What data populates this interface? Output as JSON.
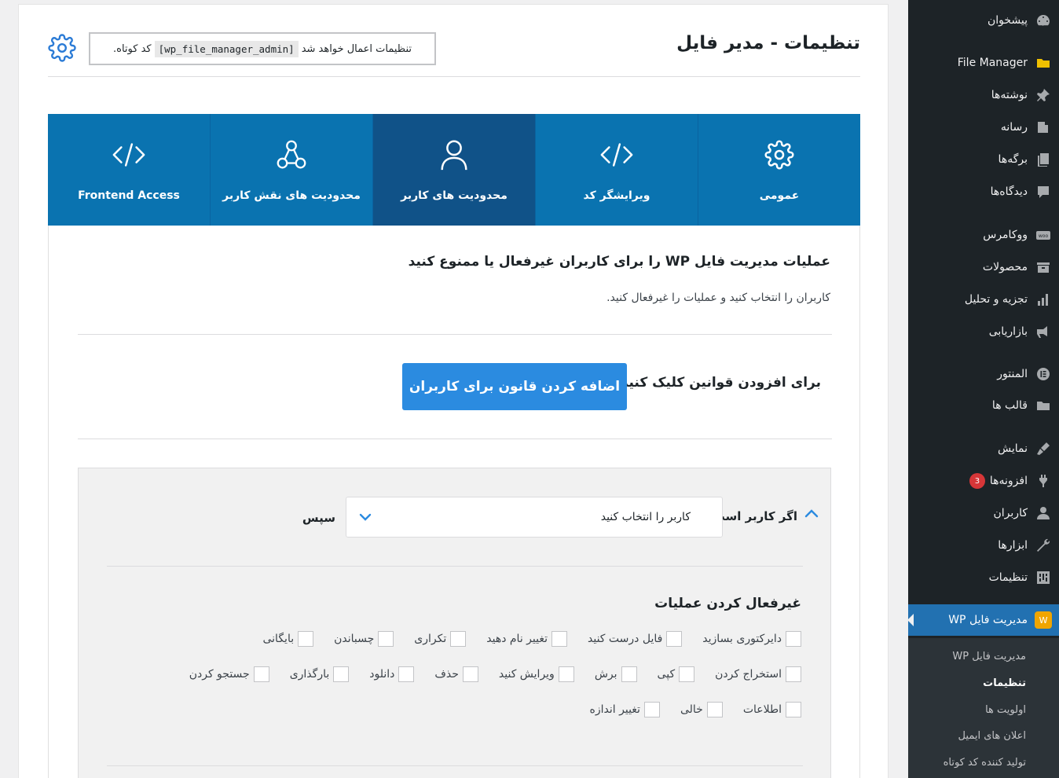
{
  "header": {
    "title": "تنظیمات - مدیر فایل",
    "shortcode_text_before": "تنظیمات اعمال خواهد شد",
    "shortcode_code": "[wp_file_manager_admin]",
    "shortcode_text_after": "کد کوتاه."
  },
  "tabs": [
    {
      "label": "Frontend Access",
      "icon": "code-icon"
    },
    {
      "label": "محدودیت های نقش کاربر",
      "icon": "user-roles-icon"
    },
    {
      "label": "محدودیت های کاربر",
      "icon": "user-icon",
      "active": true
    },
    {
      "label": "ویرایشگر کد",
      "icon": "code-icon"
    },
    {
      "label": "عمومی",
      "icon": "gear-icon"
    }
  ],
  "panel": {
    "title": "عملیات مدیریت فایل WP را برای کاربران غیرفعال یا ممنوع کنید",
    "description": "کاربران را انتخاب کنید و عملیات را غیرفعال کنید.",
    "add_rule_label": "برای افزودن قوانین کلیک کنید",
    "add_rule_button": "اضافه کردن قانون برای کاربران"
  },
  "rule": {
    "if_label": "اگر کاربر است",
    "select_placeholder": "کاربر را انتخاب کنید",
    "then_label": "سپس",
    "disable_title": "غیرفعال کردن عملیات",
    "operations_row1": [
      "دایرکتوری بسازید",
      "فایل درست کنید",
      "تغییر نام دهید",
      "تکراری",
      "چسباندن",
      "بایگانی"
    ],
    "operations_row2": [
      "استخراج کردن",
      "کپی",
      "برش",
      "ویرایش کنید",
      "حذف",
      "دانلود",
      "بارگذاری",
      "جستجو کردن"
    ],
    "operations_row3": [
      "اطلاعات",
      "خالی",
      "تغییر اندازه"
    ]
  },
  "sidebar": {
    "items": [
      {
        "label": "پیشخوان",
        "icon": "dashboard-icon"
      },
      {
        "label": "File Manager",
        "icon": "folder-icon"
      },
      {
        "label": "نوشته‌ها",
        "icon": "pin-icon"
      },
      {
        "label": "رسانه",
        "icon": "media-icon"
      },
      {
        "label": "برگه‌ها",
        "icon": "pages-icon"
      },
      {
        "label": "دیدگاه‌ها",
        "icon": "comments-icon"
      },
      {
        "label": "ووکامرس",
        "icon": "woo-icon"
      },
      {
        "label": "محصولات",
        "icon": "products-icon"
      },
      {
        "label": "تجزیه و تحلیل",
        "icon": "analytics-icon"
      },
      {
        "label": "بازاریابی",
        "icon": "megaphone-icon"
      },
      {
        "label": "المنتور",
        "icon": "elementor-icon"
      },
      {
        "label": "قالب ها",
        "icon": "templates-icon"
      },
      {
        "label": "نمایش",
        "icon": "appearance-icon"
      },
      {
        "label": "افزونه‌ها",
        "icon": "plugins-icon",
        "badge": "3"
      },
      {
        "label": "کاربران",
        "icon": "users-icon"
      },
      {
        "label": "ابزارها",
        "icon": "tools-icon"
      },
      {
        "label": "تنظیمات",
        "icon": "settings-icon"
      },
      {
        "label": "مدیریت فایل WP",
        "icon": "wp-file-manager-icon",
        "active": true
      }
    ],
    "submenu": [
      {
        "label": "مدیریت فایل WP"
      },
      {
        "label": "تنظیمات",
        "current": true
      },
      {
        "label": "اولویت ها"
      },
      {
        "label": "اعلان های ایمیل"
      },
      {
        "label": "تولید کننده کد کوتاه"
      }
    ]
  },
  "colors": {
    "tab_bg": "#0a73b0",
    "tab_active_bg": "#105288",
    "button_bg": "#2b8be0",
    "sidebar_bg": "#1d2327",
    "sidebar_active": "#2271b1"
  }
}
